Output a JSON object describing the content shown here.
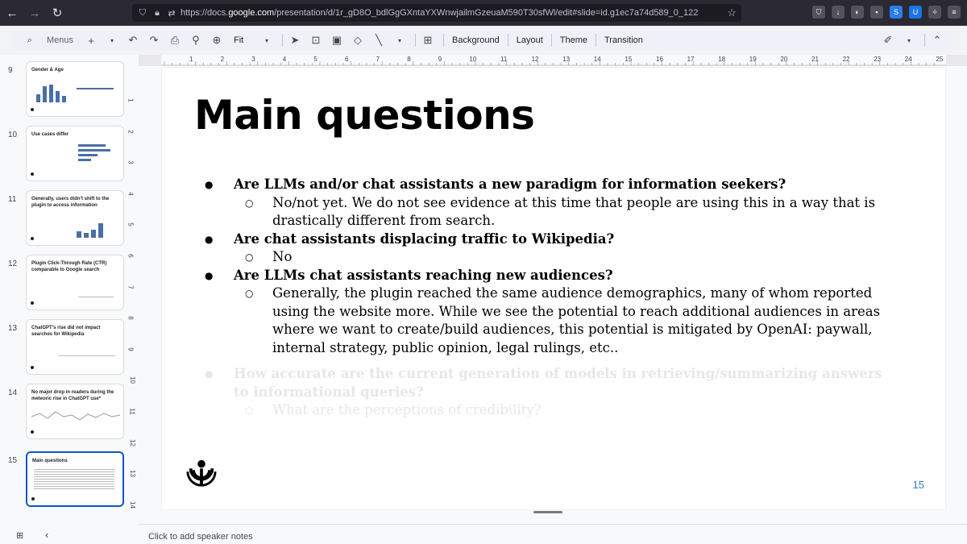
{
  "browser": {
    "url_prefix": "https://docs.",
    "url_domain": "google.com",
    "url_rest": "/presentation/d/1r_gD8O_bdlGgGXntaYXWnwjailmGzeuaM590T30sfWl/edit#slide=id.g1ec7a74d589_0_122"
  },
  "toolbar": {
    "menus_label": "Menus",
    "zoom_label": "Fit",
    "background_label": "Background",
    "layout_label": "Layout",
    "theme_label": "Theme",
    "transition_label": "Transition"
  },
  "slides": [
    {
      "num": "9",
      "title": "Gender & Age"
    },
    {
      "num": "10",
      "title": "Use cases differ"
    },
    {
      "num": "11",
      "title": "Generally, users didn't shift to the plugin to access information"
    },
    {
      "num": "12",
      "title": "Plugin Click-Through Rate (CTR) comparable to Google search"
    },
    {
      "num": "13",
      "title": "ChatGPT's rise did not impact searches for Wikipedia"
    },
    {
      "num": "14",
      "title": "No major drop in readers during the meteoric rise in ChatGPT use*"
    },
    {
      "num": "15",
      "title": "Main questions"
    }
  ],
  "ruler": {
    "top": [
      "1",
      "2",
      "3",
      "4",
      "5",
      "6",
      "7",
      "8",
      "9",
      "10",
      "11",
      "12",
      "13",
      "14",
      "15",
      "16",
      "17",
      "18",
      "19",
      "20",
      "21",
      "22",
      "23",
      "24",
      "25"
    ],
    "left": [
      "1",
      "2",
      "3",
      "4",
      "5",
      "6",
      "7",
      "8",
      "9",
      "10",
      "11",
      "12",
      "13",
      "14"
    ]
  },
  "slide": {
    "title": "Main questions",
    "q1": "Are LLMs and/or chat assistants a new paradigm for information seekers?",
    "a1": "No/not yet. We do not see evidence at this time that people are using this in a way that is drastically different from search.",
    "q2": "Are chat assistants displacing traffic to Wikipedia?",
    "a2": "No",
    "q3": "Are LLMs chat assistants reaching new audiences?",
    "a3": "Generally, the plugin reached the same audience demographics, many of whom reported using the website more. While we see the potential to reach additional audiences in areas where we want to create/build audiences, this potential is mitigated by OpenAI: paywall, internal strategy, public opinion, legal rulings, etc..",
    "q4": "How accurate are the current generation of models in retrieving/summarizing answers to informational queries?",
    "a4": "What are the perceptions of credibility?",
    "page_number": "15"
  },
  "notes": {
    "placeholder": "Click to add speaker notes"
  }
}
